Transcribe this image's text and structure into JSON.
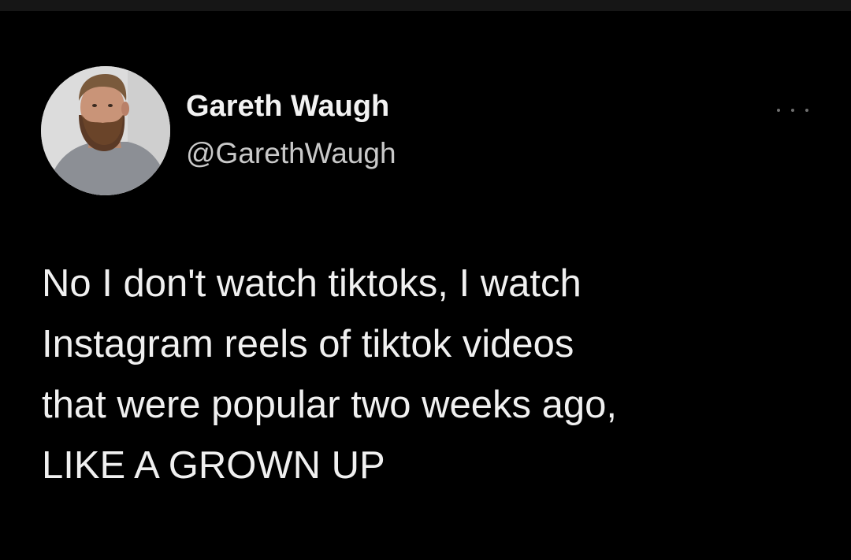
{
  "tweet": {
    "author": {
      "display_name": "Gareth Waugh",
      "handle": "@GarethWaugh"
    },
    "more_icon": "more-horizontal-icon",
    "text_lines": [
      "No I don't watch tiktoks, I watch",
      "Instagram reels of tiktok videos",
      "that were popular two weeks ago,",
      "LIKE A GROWN UP"
    ]
  },
  "colors": {
    "background": "#000000",
    "primary_text": "#f0f0f0",
    "secondary_text": "#c9c9c9"
  }
}
